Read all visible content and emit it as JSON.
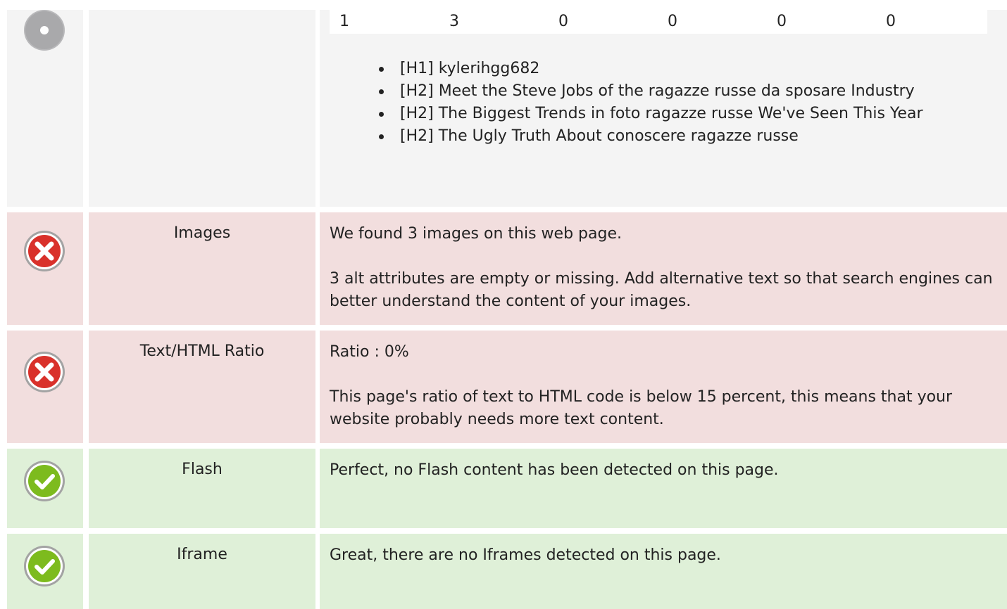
{
  "headings_row": {
    "counts": [
      "1",
      "3",
      "0",
      "0",
      "0",
      "0"
    ],
    "items": [
      "[H1] kylerihgg682",
      "[H2] Meet the Steve Jobs of the ragazze russe da sposare Industry",
      "[H2] The Biggest Trends in foto ragazze russe We've Seen This Year",
      "[H2] The Ugly Truth About conoscere ragazze russe"
    ]
  },
  "images_row": {
    "status": "error",
    "label": "Images",
    "line1": "We found 3 images on this web page.",
    "line2": "3 alt attributes are empty or missing. Add alternative text so that search engines can better understand the content of your images."
  },
  "ratio_row": {
    "status": "error",
    "label": "Text/HTML Ratio",
    "line1": "Ratio : 0%",
    "line2": "This page's ratio of text to HTML code is below 15 percent, this means that your website probably needs more text content."
  },
  "flash_row": {
    "status": "ok",
    "label": "Flash",
    "line1": "Perfect, no Flash content has been detected on this page."
  },
  "iframe_row": {
    "status": "ok",
    "label": "Iframe",
    "line1": "Great, there are no Iframes detected on this page."
  },
  "colors": {
    "error_bg": "#f2dede",
    "ok_bg": "#dff0d8",
    "neutral_bg": "#f4f4f4",
    "error_icon": "#d9312b",
    "ok_icon": "#7dbb1e"
  }
}
